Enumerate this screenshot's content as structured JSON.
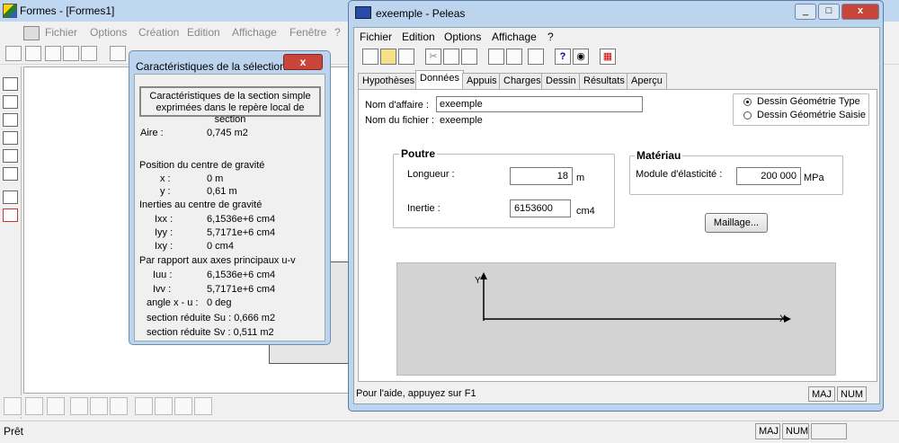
{
  "bg_app": {
    "title": "Formes - [Formes1]",
    "menu": [
      "Fichier",
      "Options",
      "Création",
      "Edition",
      "Affichage",
      "Fenêtre",
      "?"
    ],
    "status": "Prêt",
    "status_maj": "MAJ",
    "status_num": "NUM"
  },
  "sel_dialog": {
    "title": "Caractéristiques de la sélection",
    "close": "x",
    "heading_line1": "Caractéristiques de la section simple",
    "heading_line2": "exprimées dans le repère local de section",
    "aire_label": "Aire :",
    "aire_value": "0,745  m2",
    "gravity_title": "Position du centre de gravité",
    "x_label": "x :",
    "x_value": "0  m",
    "y_label": "y :",
    "y_value": "0,61  m",
    "inertia_title": "Inerties au centre de gravité",
    "ixx_label": "Ixx :",
    "ixx_value": "6,1536e+6  cm4",
    "iyy_label": "Iyy :",
    "iyy_value": "5,7171e+6  cm4",
    "ixy_label": "Ixy :",
    "ixy_value": "0  cm4",
    "principal_title": "Par rapport aux axes principaux u-v",
    "iuu_label": "Iuu :",
    "iuu_value": "6,1536e+6  cm4",
    "ivv_label": "Ivv :",
    "ivv_value": "5,7171e+6  cm4",
    "angle_label": "angle x - u :",
    "angle_value": "0  deg",
    "su_text": "section réduite Su : 0,666  m2",
    "sv_text": "section réduite Sv : 0,511  m2"
  },
  "peleas": {
    "title": "exeemple - Peleas",
    "menu": [
      "Fichier",
      "Edition",
      "Options",
      "Affichage",
      "?"
    ],
    "tabs": [
      "Hypothèses",
      "Données",
      "Appuis",
      "Charges",
      "Dessin",
      "Résultats",
      "Aperçu"
    ],
    "active_tab": "Données",
    "nom_affaire_label": "Nom d'affaire :",
    "nom_affaire_value": "exeemple",
    "nom_fichier_label": "Nom du fichier :",
    "nom_fichier_value": "exeemple",
    "radio_type": "Dessin Géométrie Type",
    "radio_saisie": "Dessin Géométrie Saisie",
    "poutre_title": "Poutre",
    "longueur_label": "Longueur :",
    "longueur_value": "18",
    "longueur_unit": "m",
    "inertie_label": "Inertie :",
    "inertie_value": "6153600",
    "inertie_unit": "cm4",
    "materiau_title": "Matériau",
    "module_label": "Module d'élasticité :",
    "module_value": "200 000",
    "module_unit": "MPa",
    "maillage_button": "Maillage...",
    "axis_x": "X",
    "axis_y": "Y",
    "status_help": "Pour l'aide, appuyez sur F1",
    "status_maj": "MAJ",
    "status_num": "NUM"
  }
}
